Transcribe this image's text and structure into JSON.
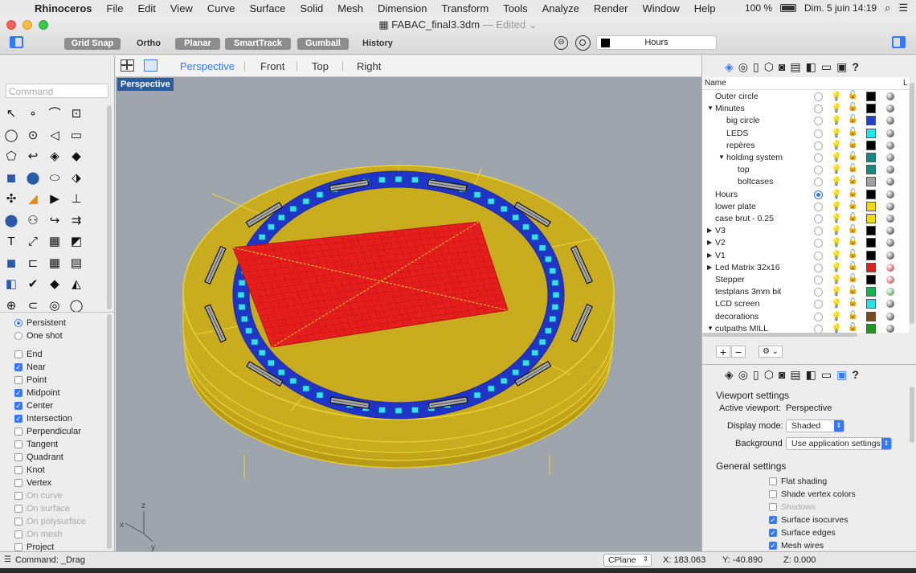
{
  "menubar": {
    "app": "Rhinoceros",
    "items": [
      "File",
      "Edit",
      "View",
      "Curve",
      "Surface",
      "Solid",
      "Mesh",
      "Dimension",
      "Transform",
      "Tools",
      "Analyze",
      "Render",
      "Window",
      "Help"
    ],
    "battery": "100 %",
    "datetime": "Dim. 5 juin  14:19"
  },
  "window": {
    "title": "FABAC_final3.3dm",
    "edited": "— Edited ⌄",
    "units": "Hours"
  },
  "toolbar": {
    "grid_snap": "Grid Snap",
    "ortho": "Ortho",
    "planar": "Planar",
    "smarttrack": "SmartTrack",
    "gumball": "Gumball",
    "history": "History"
  },
  "command": {
    "placeholder": "Command",
    "status": "Command: _Drag"
  },
  "osnap": {
    "persistent": "Persistent",
    "one_shot": "One shot",
    "items": [
      {
        "label": "End",
        "checked": false,
        "enabled": true
      },
      {
        "label": "Near",
        "checked": true,
        "enabled": true
      },
      {
        "label": "Point",
        "checked": false,
        "enabled": true
      },
      {
        "label": "Midpoint",
        "checked": true,
        "enabled": true
      },
      {
        "label": "Center",
        "checked": true,
        "enabled": true
      },
      {
        "label": "Intersection",
        "checked": true,
        "enabled": true
      },
      {
        "label": "Perpendicular",
        "checked": false,
        "enabled": true
      },
      {
        "label": "Tangent",
        "checked": false,
        "enabled": true
      },
      {
        "label": "Quadrant",
        "checked": false,
        "enabled": true
      },
      {
        "label": "Knot",
        "checked": false,
        "enabled": true
      },
      {
        "label": "Vertex",
        "checked": false,
        "enabled": true
      },
      {
        "label": "On curve",
        "checked": false,
        "enabled": false
      },
      {
        "label": "On surface",
        "checked": false,
        "enabled": false
      },
      {
        "label": "On polysurface",
        "checked": false,
        "enabled": false
      },
      {
        "label": "On mesh",
        "checked": false,
        "enabled": false
      },
      {
        "label": "Project",
        "checked": false,
        "enabled": true
      }
    ]
  },
  "viewport_tabs": {
    "perspective": "Perspective",
    "front": "Front",
    "top": "Top",
    "right": "Right"
  },
  "viewport": {
    "label": "Perspective",
    "axis_x": "x",
    "axis_y": "y",
    "axis_z": "z"
  },
  "layers": {
    "header_name": "Name",
    "header_l": "L",
    "items": [
      {
        "name": "Outer circle",
        "indent": 0,
        "arrow": "",
        "current": false,
        "bulb": "off",
        "color": "#000000",
        "mat": "#222"
      },
      {
        "name": "Minutes",
        "indent": 0,
        "arrow": "▼",
        "current": false,
        "bulb": "on",
        "color": "#000000",
        "mat": "#222"
      },
      {
        "name": "big circle",
        "indent": 1,
        "arrow": "",
        "current": false,
        "bulb": "on",
        "color": "#1f3fd8",
        "mat": "#222"
      },
      {
        "name": "LEDS",
        "indent": 1,
        "arrow": "",
        "current": false,
        "bulb": "on",
        "color": "#1ee8ee",
        "mat": "#222"
      },
      {
        "name": "repères",
        "indent": 1,
        "arrow": "",
        "current": false,
        "bulb": "off",
        "color": "#000000",
        "mat": "#222"
      },
      {
        "name": "holding system",
        "indent": 1,
        "arrow": "▼",
        "current": false,
        "bulb": "off",
        "color": "#0f8a86",
        "mat": "#222"
      },
      {
        "name": "top",
        "indent": 2,
        "arrow": "",
        "current": false,
        "bulb": "off",
        "color": "#0f8a86",
        "mat": "#222"
      },
      {
        "name": "boltcases",
        "indent": 2,
        "arrow": "",
        "current": false,
        "bulb": "off",
        "color": "#a0a0a0",
        "mat": "#222"
      },
      {
        "name": "Hours",
        "indent": 0,
        "arrow": "",
        "current": true,
        "bulb": "dim",
        "color": "#000000",
        "mat": "#222"
      },
      {
        "name": "lower plate",
        "indent": 0,
        "arrow": "",
        "current": false,
        "bulb": "off",
        "color": "#f5d800",
        "mat": "#222"
      },
      {
        "name": "case brut - 0.25",
        "indent": 0,
        "arrow": "",
        "current": false,
        "bulb": "on",
        "color": "#f5d800",
        "mat": "#222"
      },
      {
        "name": "V3",
        "indent": 0,
        "arrow": "▶",
        "current": false,
        "bulb": "off",
        "color": "#000000",
        "mat": "#222"
      },
      {
        "name": "V2",
        "indent": 0,
        "arrow": "▶",
        "current": false,
        "bulb": "off",
        "color": "#000000",
        "mat": "#222"
      },
      {
        "name": "V1",
        "indent": 0,
        "arrow": "▶",
        "current": false,
        "bulb": "off",
        "color": "#000000",
        "mat": "#222"
      },
      {
        "name": "Led Matrix 32x16",
        "indent": 0,
        "arrow": "▶",
        "current": false,
        "bulb": "on",
        "color": "#e02020",
        "mat": "#c02020"
      },
      {
        "name": "Stepper",
        "indent": 0,
        "arrow": "",
        "current": false,
        "bulb": "off",
        "color": "#000000",
        "mat": "#c02020"
      },
      {
        "name": "testplans 3mm bit",
        "indent": 0,
        "arrow": "",
        "current": false,
        "bulb": "off",
        "color": "#0fb84a",
        "mat": "#2a8a2a"
      },
      {
        "name": "LCD screen",
        "indent": 0,
        "arrow": "",
        "current": false,
        "bulb": "off",
        "color": "#1ee8ee",
        "mat": "#222"
      },
      {
        "name": "decorations",
        "indent": 0,
        "arrow": "",
        "current": false,
        "bulb": "off",
        "color": "#7a4a18",
        "mat": "#222"
      },
      {
        "name": "cutpaths MILL",
        "indent": 0,
        "arrow": "▼",
        "current": false,
        "bulb": "off",
        "color": "#1a9a1a",
        "mat": "#222"
      }
    ]
  },
  "layer_buttons": {
    "add": "+",
    "remove": "−",
    "gear": "⚙ ⌄"
  },
  "properties": {
    "section": "Viewport settings",
    "active_label": "Active viewport:",
    "active_value": "Perspective",
    "display_label": "Display mode:",
    "display_value": "Shaded",
    "bg_label": "Background",
    "bg_value": "Use application settings",
    "general": "General settings",
    "options": [
      {
        "label": "Flat shading",
        "checked": false,
        "enabled": true
      },
      {
        "label": "Shade vertex colors",
        "checked": false,
        "enabled": true
      },
      {
        "label": "Shadows",
        "checked": false,
        "enabled": false
      },
      {
        "label": "Surface isocurves",
        "checked": true,
        "enabled": true
      },
      {
        "label": "Surface edges",
        "checked": true,
        "enabled": true
      },
      {
        "label": "Mesh wires",
        "checked": true,
        "enabled": true
      }
    ]
  },
  "status": {
    "cplane": "CPlane",
    "x": "X: 183.063",
    "y": "Y: -40.890",
    "z": "Z: 0.000"
  },
  "colors": {
    "accent": "#3478f6",
    "case": "#c9ab1e",
    "ring": "#2035c8",
    "led": "#36e0ea",
    "matrix": "#e61e1e",
    "viewport_bg": "#9ea4ac"
  }
}
